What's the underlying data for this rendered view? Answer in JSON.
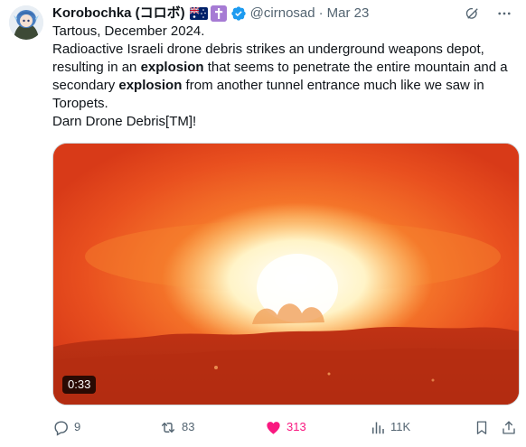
{
  "author": {
    "display_name": "Korobochka (コロボ)",
    "handle": "@cirnosad",
    "separator": "·",
    "timestamp": "Mar 23",
    "avatar_icon": "anime-avatar-icon",
    "badges": [
      "australia-flag-icon",
      "cross-badge-icon",
      "verified-icon"
    ]
  },
  "tweet": {
    "lines": [
      {
        "parts": [
          {
            "text": "Tartous, December 2024.",
            "bold": false
          }
        ]
      },
      {
        "parts": [
          {
            "text": "Radioactive Israeli drone debris strikes an underground weapons depot, resulting in an ",
            "bold": false
          },
          {
            "text": "explosion",
            "bold": true
          },
          {
            "text": " that seems to penetrate the entire mountain and a secondary ",
            "bold": false
          },
          {
            "text": "explosion",
            "bold": true
          },
          {
            "text": " from another tunnel entrance much like we saw in Toropets.",
            "bold": false
          }
        ]
      },
      {
        "parts": [
          {
            "text": "Darn Drone Debris[TM]!",
            "bold": false
          }
        ]
      }
    ]
  },
  "media": {
    "type": "video",
    "duration": "0:33",
    "description_icon": "explosion-video-thumbnail"
  },
  "actions": {
    "replies": "9",
    "reposts": "83",
    "likes": "313",
    "views": "11K",
    "liked": true,
    "colors": {
      "muted": "#536471",
      "like": "#f91880",
      "verified": "#1d9bf0"
    }
  }
}
